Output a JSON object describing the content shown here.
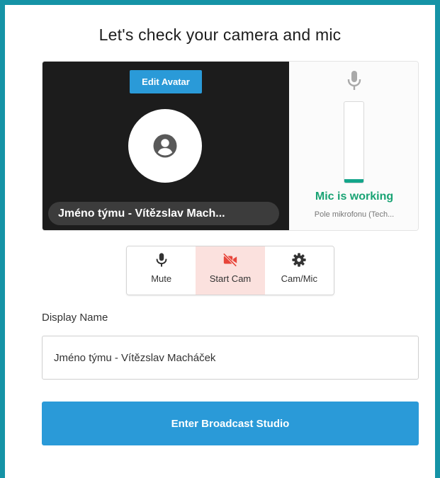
{
  "dialog": {
    "title": "Let's check your camera and mic"
  },
  "preview": {
    "edit_avatar_label": "Edit Avatar",
    "name_tag": "Jméno týmu - Vítězslav Mach...",
    "avatar_icon": "user-circle-icon"
  },
  "mic": {
    "icon": "microphone-icon",
    "level": 0.04,
    "status": "Mic is working",
    "device": "Pole mikrofonu (Tech...",
    "status_color": "#19a374"
  },
  "controls": [
    {
      "label": "Mute",
      "icon": "microphone-icon"
    },
    {
      "label": "Start Cam",
      "icon": "camera-off-icon",
      "active": true
    },
    {
      "label": "Cam/Mic",
      "icon": "gear-icon"
    }
  ],
  "form": {
    "display_name_label": "Display Name",
    "display_name_value": "Jméno týmu - Vítězslav Macháček"
  },
  "actions": {
    "enter_label": "Enter Broadcast Studio"
  },
  "colors": {
    "accent": "#2a9ad8",
    "frame": "#1593a6",
    "cam_off": "#e7453a"
  }
}
